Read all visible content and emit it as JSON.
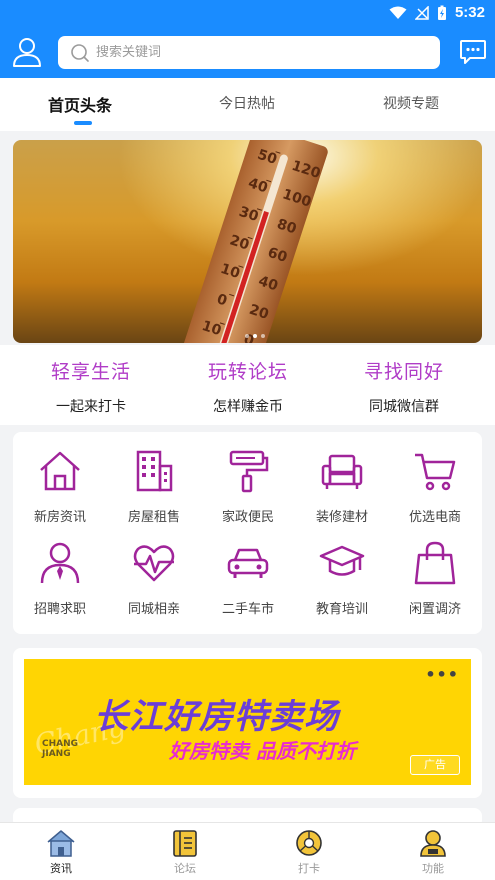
{
  "status": {
    "time": "5:32"
  },
  "search": {
    "placeholder": "搜索关键词"
  },
  "tabs": [
    {
      "label": "首页头条",
      "active": true
    },
    {
      "label": "今日热帖",
      "active": false
    },
    {
      "label": "视频专题",
      "active": false
    }
  ],
  "banner": {
    "slides": 3,
    "active_slide": 1
  },
  "features": [
    {
      "title": "轻享生活",
      "sub": "一起来打卡"
    },
    {
      "title": "玩转论坛",
      "sub": "怎样赚金币"
    },
    {
      "title": "寻找同好",
      "sub": "同城微信群"
    }
  ],
  "categories": [
    {
      "label": "新房资讯",
      "icon": "house-icon"
    },
    {
      "label": "房屋租售",
      "icon": "building-icon"
    },
    {
      "label": "家政便民",
      "icon": "paint-roller-icon"
    },
    {
      "label": "装修建材",
      "icon": "sofa-icon"
    },
    {
      "label": "优选电商",
      "icon": "cart-icon"
    },
    {
      "label": "招聘求职",
      "icon": "person-tie-icon"
    },
    {
      "label": "同城相亲",
      "icon": "heart-pulse-icon"
    },
    {
      "label": "二手车市",
      "icon": "car-icon"
    },
    {
      "label": "教育培训",
      "icon": "graduation-cap-icon"
    },
    {
      "label": "闲置调济",
      "icon": "shopping-bag-icon"
    }
  ],
  "ad": {
    "title": "长江好房特卖场",
    "subtitle": "好房特卖 品质不打折",
    "brand_en": "CHANG\nJIANG",
    "tag": "广告",
    "more": "•••",
    "colors": {
      "background": "#ffd503",
      "title": "#6b3ed8",
      "subtitle": "#e82ccf"
    }
  },
  "bottom_nav": [
    {
      "label": "资讯",
      "icon": "news-home-icon",
      "active": true
    },
    {
      "label": "论坛",
      "icon": "forum-book-icon",
      "active": false
    },
    {
      "label": "打卡",
      "icon": "checkin-icon",
      "active": false
    },
    {
      "label": "功能",
      "icon": "profile-function-icon",
      "active": false
    }
  ],
  "colors": {
    "primary": "#1a8cff",
    "accent": "#b03cc7",
    "icon": "#a0249a"
  }
}
